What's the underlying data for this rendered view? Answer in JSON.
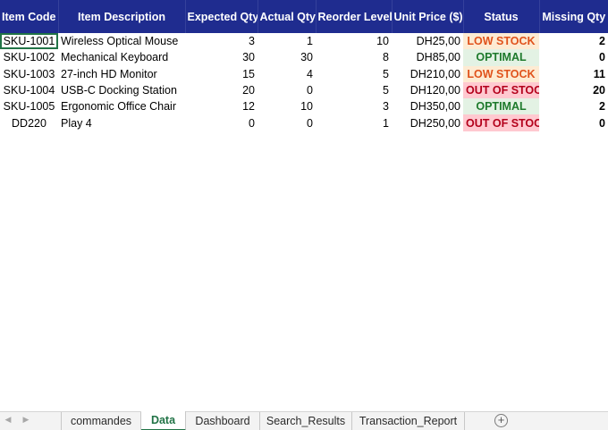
{
  "headers": {
    "item_code": "Item Code",
    "item_description": "Item Description",
    "expected_qty": "Expected Qty",
    "actual_qty": "Actual Qty",
    "reorder_level": "Reorder Level",
    "unit_price": "Unit Price ($)",
    "status": "Status",
    "missing_qty": "Missing Qty"
  },
  "rows": [
    {
      "code": "SKU-1001",
      "description": "Wireless Optical Mouse",
      "expected": "3",
      "actual": "1",
      "reorder": "10",
      "price": "DH25,00",
      "status": "LOW STOCK",
      "missing": "2"
    },
    {
      "code": "SKU-1002",
      "description": "Mechanical Keyboard",
      "expected": "30",
      "actual": "30",
      "reorder": "8",
      "price": "DH85,00",
      "status": "OPTIMAL",
      "missing": "0"
    },
    {
      "code": "SKU-1003",
      "description": "27-inch HD Monitor",
      "expected": "15",
      "actual": "4",
      "reorder": "5",
      "price": "DH210,00",
      "status": "LOW STOCK",
      "missing": "11"
    },
    {
      "code": "SKU-1004",
      "description": "USB-C Docking Station",
      "expected": "20",
      "actual": "0",
      "reorder": "5",
      "price": "DH120,00",
      "status": "OUT OF STOCK",
      "missing": "20"
    },
    {
      "code": "SKU-1005",
      "description": "Ergonomic Office Chair",
      "expected": "12",
      "actual": "10",
      "reorder": "3",
      "price": "DH350,00",
      "status": "OPTIMAL",
      "missing": "2"
    },
    {
      "code": "DD220",
      "description": "Play 4",
      "expected": "0",
      "actual": "0",
      "reorder": "1",
      "price": "DH250,00",
      "status": "OUT OF STOCK",
      "missing": "0"
    }
  ],
  "status_colors": {
    "LOW STOCK": {
      "bg": "#fdebd3",
      "fg": "#e0521b"
    },
    "OPTIMAL": {
      "bg": "#e3f2e4",
      "fg": "#1e7a2c"
    },
    "OUT OF STOCK": {
      "bg": "#ffc9d0",
      "fg": "#b3001b"
    }
  },
  "header_color": "#1f2c8f",
  "sheet_tabs": [
    {
      "label": "commandes",
      "active": false
    },
    {
      "label": "Data",
      "active": true
    },
    {
      "label": "Dashboard",
      "active": false
    },
    {
      "label": "Search_Results",
      "active": false
    },
    {
      "label": "Transaction_Report",
      "active": false
    }
  ],
  "icons": {
    "scroll_left": "caret-left-icon",
    "scroll_right": "caret-right-icon",
    "add_sheet": "plus-circle-icon"
  }
}
